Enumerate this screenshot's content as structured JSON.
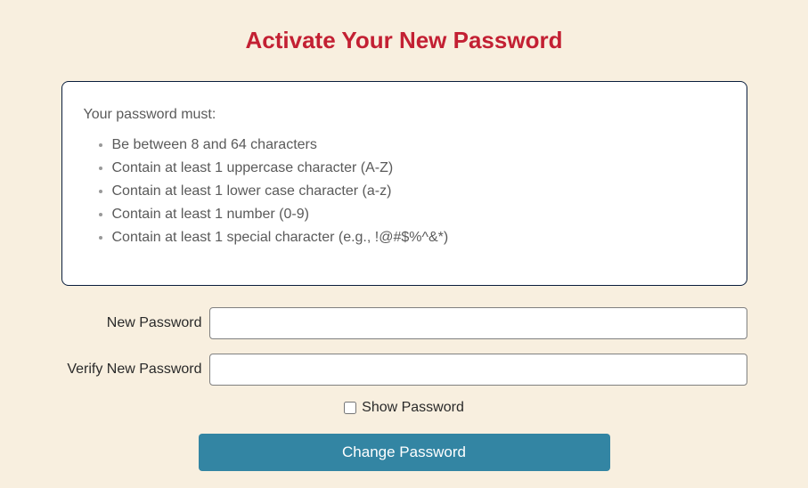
{
  "title": "Activate Your New Password",
  "requirements": {
    "heading": "Your password must:",
    "items": [
      "Be between 8 and 64 characters",
      "Contain at least 1 uppercase character (A-Z)",
      "Contain at least 1 lower case character (a-z)",
      "Contain at least 1 number (0-9)",
      "Contain at least 1 special character (e.g., !@#$%^&*)"
    ]
  },
  "form": {
    "new_password_label": "New Password",
    "new_password_value": "",
    "verify_password_label": "Verify New Password",
    "verify_password_value": "",
    "show_password_label": "Show Password",
    "submit_label": "Change Password"
  },
  "colors": {
    "background": "#f8efdf",
    "title": "#c32033",
    "border": "#0a1e3d",
    "button": "#3385a3"
  }
}
